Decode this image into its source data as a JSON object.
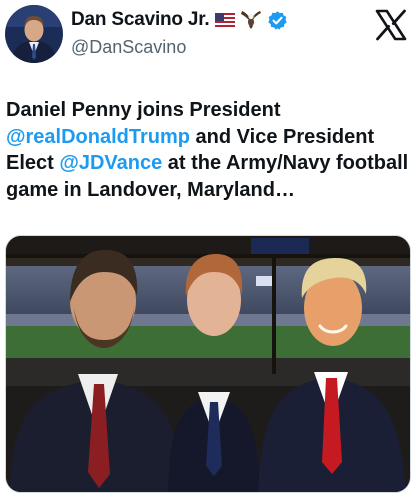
{
  "author": {
    "display_name": "Dan Scavino Jr.",
    "handle": "@DanScavino",
    "verified": true,
    "name_emojis": [
      "us-flag-icon",
      "eagle-icon"
    ]
  },
  "platform": {
    "logo": "x-logo-icon"
  },
  "tweet": {
    "text_parts": {
      "part1": "Daniel Penny joins President ",
      "mention1": "@realDonaldTrump",
      "part2": " and Vice President Elect ",
      "mention2": "@JDVance",
      "part3": " at the Army/Navy football game in Landover, Maryland…"
    }
  },
  "media": {
    "kind": "photo",
    "subject": "three-men-at-stadium-photo"
  },
  "colors": {
    "link": "#1d9bf0",
    "text": "#0f1419",
    "secondary": "#536471",
    "verified": "#1d9bf0"
  }
}
